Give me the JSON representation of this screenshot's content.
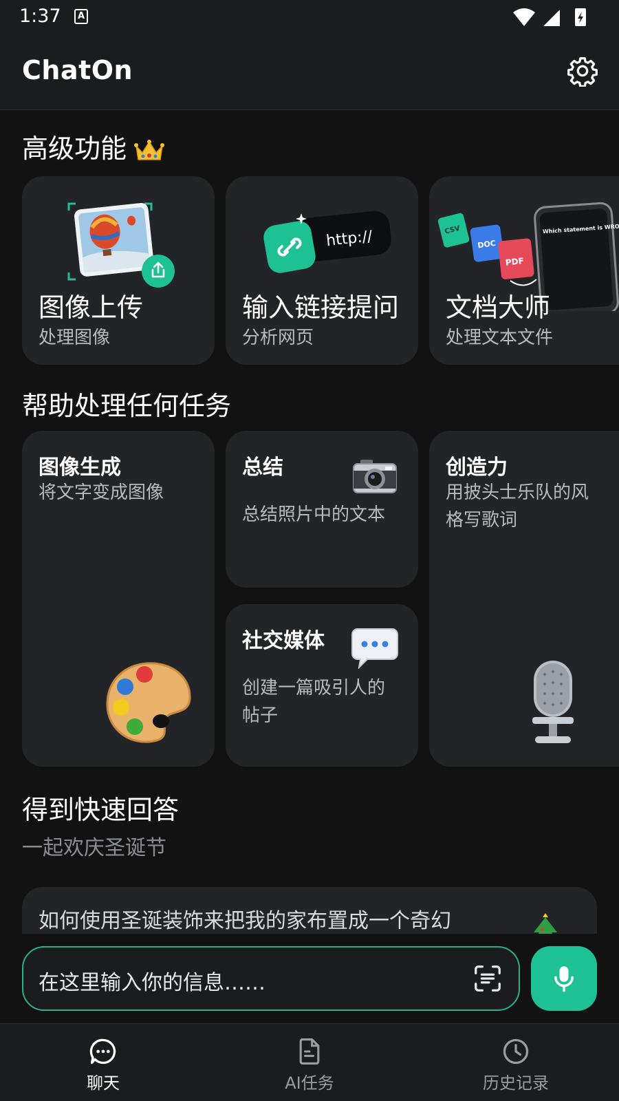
{
  "status_bar": {
    "time": "1:37",
    "notification_badge": "A"
  },
  "app": {
    "title": "ChatOn"
  },
  "premium": {
    "title": "高级功能",
    "cards": [
      {
        "title": "图像上传",
        "subtitle": "处理图像"
      },
      {
        "title": "输入链接提问",
        "subtitle": "分析网页",
        "link_text": "http://"
      },
      {
        "title": "文档大师",
        "subtitle": "处理文本文件",
        "file_badges": [
          "CSV",
          "DOC",
          "PDF"
        ],
        "phone_text": "Which statement is WRONG about water?"
      }
    ]
  },
  "tasks": {
    "title": "帮助处理任何任务",
    "cards": [
      {
        "title": "图像生成",
        "desc": "将文字变成图像"
      },
      {
        "title": "总结",
        "desc": "总结照片中的文本"
      },
      {
        "title": "创造力",
        "desc_line1": "用披头士乐队的风",
        "desc_line2": "格写歌词"
      },
      {
        "title": "社交媒体",
        "desc_line1": "创建一篇吸引人的",
        "desc_line2": "帖子"
      }
    ]
  },
  "quick": {
    "title": "得到快速回答",
    "subtitle": "一起欢庆圣诞节",
    "prompt": "如何使用圣诞装饰来把我的家布置成一个奇幻"
  },
  "input": {
    "placeholder": "在这里输入你的信息……"
  },
  "nav": {
    "items": [
      {
        "label": "聊天",
        "active": true
      },
      {
        "label": "AI任务",
        "active": false
      },
      {
        "label": "历史记录",
        "active": false
      }
    ]
  },
  "colors": {
    "accent": "#1ec193",
    "background": "#121213",
    "card": "#232427",
    "nav_active": "#ffffff",
    "nav_inactive": "#9a9ca0"
  }
}
